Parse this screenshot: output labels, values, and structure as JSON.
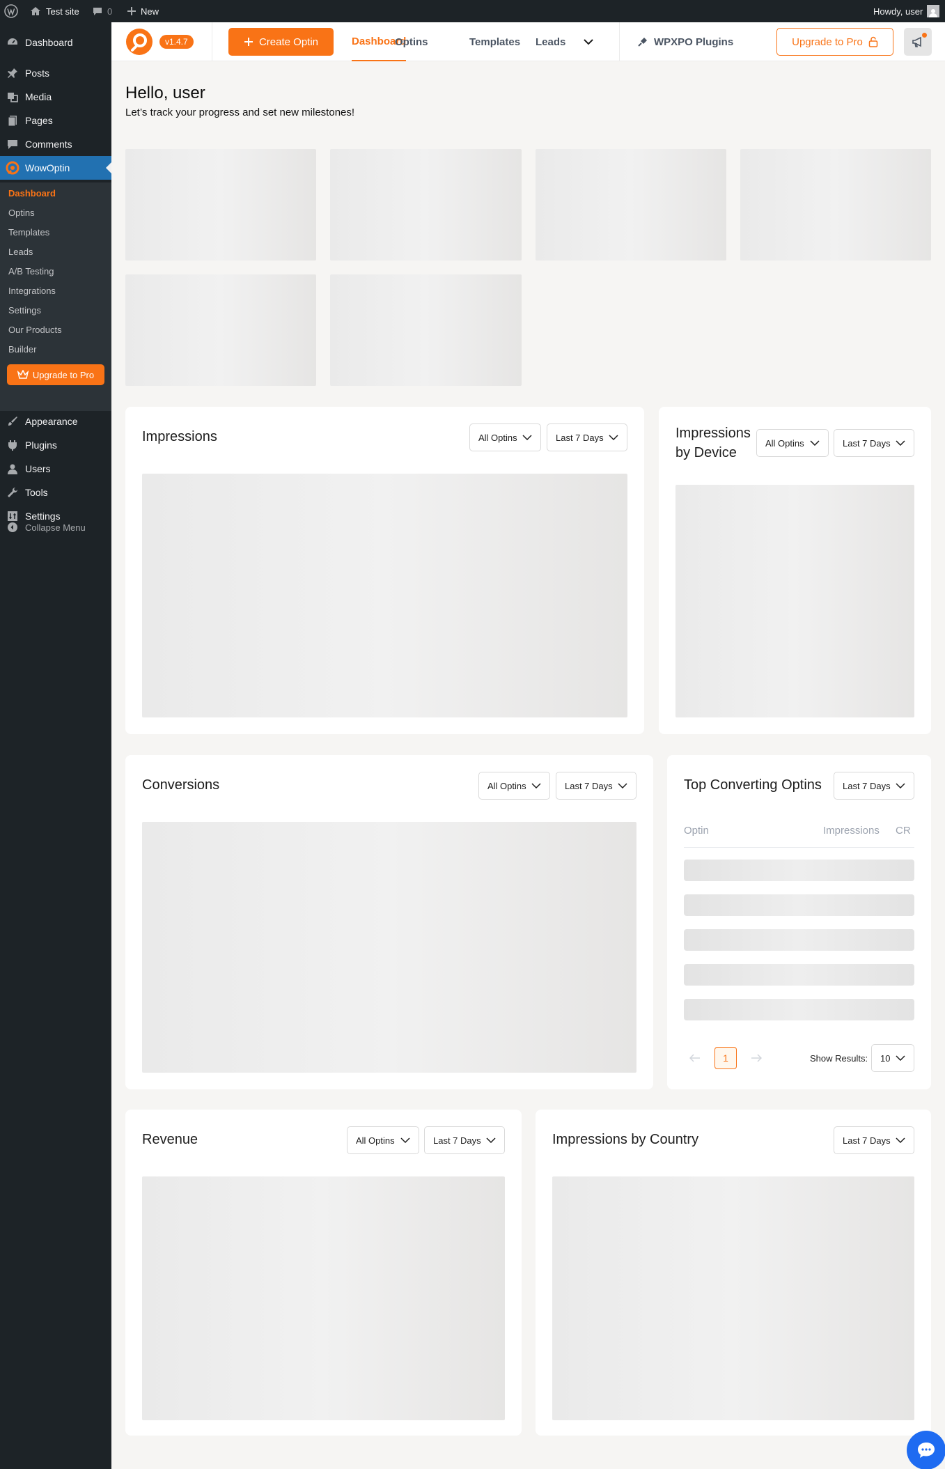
{
  "adminbar": {
    "site_name": "Test site",
    "comments_count": "0",
    "new_label": "New",
    "howdy": "Howdy, user"
  },
  "sidebar": {
    "items": [
      {
        "label": "Dashboard",
        "icon": "dashboard-icon"
      },
      {
        "label": "Posts",
        "icon": "pin-icon"
      },
      {
        "label": "Media",
        "icon": "media-icon"
      },
      {
        "label": "Pages",
        "icon": "pages-icon"
      },
      {
        "label": "Comments",
        "icon": "comment-icon"
      },
      {
        "label": "WowOptin",
        "icon": "wowoptin-icon"
      },
      {
        "label": "Appearance",
        "icon": "brush-icon"
      },
      {
        "label": "Plugins",
        "icon": "plug-icon"
      },
      {
        "label": "Users",
        "icon": "user-icon"
      },
      {
        "label": "Tools",
        "icon": "wrench-icon"
      },
      {
        "label": "Settings",
        "icon": "settings-icon"
      }
    ],
    "submenu": [
      "Dashboard",
      "Optins",
      "Templates",
      "Leads",
      "A/B Testing",
      "Integrations",
      "Settings",
      "Our Products",
      "Builder"
    ],
    "upgrade_label": "Upgrade to Pro",
    "collapse_label": "Collapse Menu"
  },
  "topnav": {
    "version": "v1.4.7",
    "create_label": "Create Optin",
    "links": [
      "Dashboard",
      "Optins",
      "Templates",
      "Leads"
    ],
    "wpxpo_label": "WPXPO Plugins",
    "upgrade_label": "Upgrade to Pro"
  },
  "greeting": {
    "title": "Hello, user",
    "subtitle": "Let’s track your progress and set new milestones!"
  },
  "cards": {
    "impressions": {
      "title": "Impressions",
      "optins_filter": "All Optins",
      "range_filter": "Last 7 Days"
    },
    "by_device": {
      "title_line1": "Impressions",
      "title_line2": "by Device",
      "optins_filter": "All Optins",
      "range_filter": "Last 7 Days"
    },
    "conversions": {
      "title": "Conversions",
      "optins_filter": "All Optins",
      "range_filter": "Last 7 Days"
    },
    "top_converting": {
      "title": "Top Converting Optins",
      "range_filter": "Last 7 Days",
      "columns": [
        "Optin",
        "Impressions",
        "CR"
      ],
      "current_page": "1",
      "show_results_label": "Show Results:",
      "show_results_value": "10"
    },
    "revenue": {
      "title": "Revenue",
      "optins_filter": "All Optins",
      "range_filter": "Last 7 Days"
    },
    "by_country": {
      "title": "Impressions by Country",
      "range_filter": "Last 7 Days"
    }
  },
  "colors": {
    "accent": "#f97316",
    "admin_dark": "#1d2327",
    "admin_blue": "#2271b1",
    "chat_blue": "#1e6bf1"
  }
}
